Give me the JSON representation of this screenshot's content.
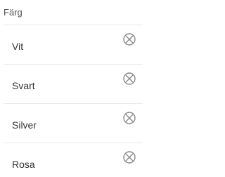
{
  "panel": {
    "title": "Färg"
  },
  "options": [
    {
      "label": "Vit",
      "icon": "remove-icon"
    },
    {
      "label": "Svart",
      "icon": "remove-icon"
    },
    {
      "label": "Silver",
      "icon": "remove-icon"
    },
    {
      "label": "Rosa",
      "icon": "remove-icon"
    }
  ],
  "colors": {
    "icon": "#8a8a8a",
    "divider": "#e8e8e8",
    "title_text": "#555555",
    "item_text": "#333333"
  }
}
